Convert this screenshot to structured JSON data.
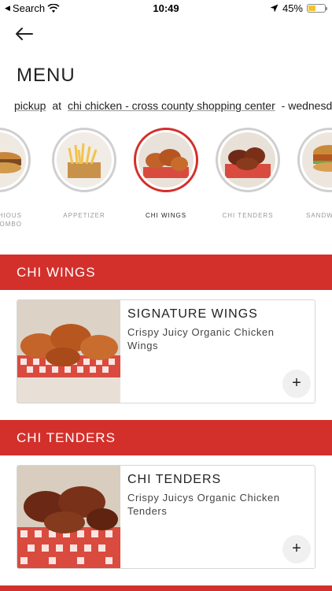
{
  "status_bar": {
    "back_app": "Search",
    "time": "10:49",
    "battery_pct": "45%",
    "battery_level": 0.45,
    "icons": [
      "wifi-icon",
      "location-arrow-icon",
      "battery-charging-icon"
    ]
  },
  "header": {
    "back_icon": "arrow-left-icon",
    "title": "MENU"
  },
  "order_info": {
    "mode": "pickup",
    "at": "at",
    "location": "chi chicken - cross county shopping center",
    "separator": "-",
    "day": "wednesday"
  },
  "categories": [
    {
      "label": "DELICHIOUS COMBO",
      "visible_label": "CHIOUS COMBO",
      "active": false
    },
    {
      "label": "APPETIZER",
      "active": false
    },
    {
      "label": "CHI WINGS",
      "active": true
    },
    {
      "label": "CHI TENDERS",
      "active": false
    },
    {
      "label": "SANDWICHES & WRAPS",
      "visible_label": "SANDW WRA",
      "active": false
    }
  ],
  "sections": [
    {
      "title": "CHI WINGS",
      "items": [
        {
          "name": "SIGNATURE WINGS",
          "description": "Crispy Juicy Organic Chicken Wings",
          "add_label": "+"
        }
      ]
    },
    {
      "title": "CHI TENDERS",
      "items": [
        {
          "name": "CHI TENDERS",
          "description": "Crispy Juicys Organic Chicken Tenders",
          "add_label": "+"
        }
      ]
    }
  ],
  "colors": {
    "accent": "#d3302b",
    "ring_inactive": "#cfcfcf",
    "card_border": "#d6d6d6"
  }
}
